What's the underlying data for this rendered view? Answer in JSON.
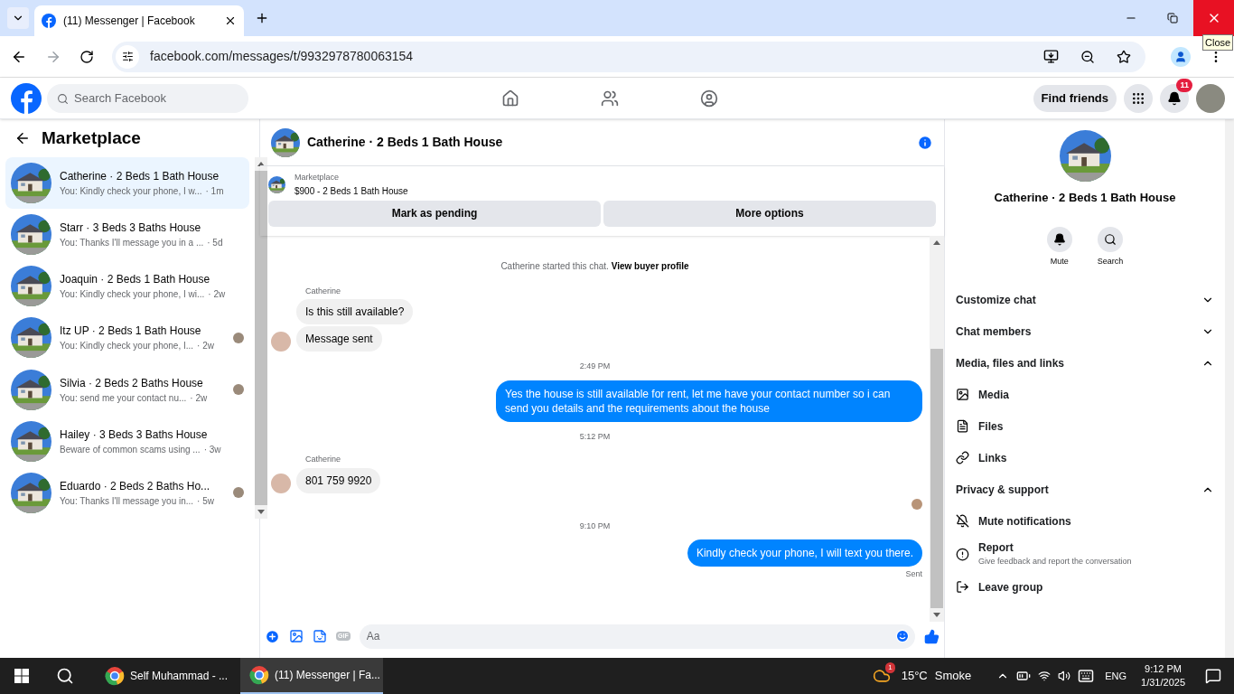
{
  "browser": {
    "tab_title": "(11) Messenger | Facebook",
    "url": "facebook.com/messages/t/9932978780063154",
    "tooltip": "Close"
  },
  "facebook_header": {
    "search_placeholder": "Search Facebook",
    "find_friends": "Find friends",
    "notification_count": "11"
  },
  "sidebar": {
    "title": "Marketplace",
    "conversations": [
      {
        "title": "Catherine · 2 Beds 1 Bath House",
        "preview": "You: Kindly check your phone, I w...",
        "time": "· 1m",
        "selected": true,
        "seen_avatar": false
      },
      {
        "title": "Starr · 3 Beds 3 Baths House",
        "preview": "You: Thanks I'll message you in a ...",
        "time": "· 5d",
        "selected": false,
        "seen_avatar": false
      },
      {
        "title": "Joaquin · 2 Beds 1 Bath House",
        "preview": "You: Kindly check your phone, I wi...",
        "time": "· 2w",
        "selected": false,
        "seen_avatar": false
      },
      {
        "title": "Itz UP · 2 Beds 1 Bath House",
        "preview": "You: Kindly check your phone, I...",
        "time": "· 2w",
        "selected": false,
        "seen_avatar": true
      },
      {
        "title": "Silvia · 2 Beds 2 Baths House",
        "preview": "You: send me your contact nu...",
        "time": "· 2w",
        "selected": false,
        "seen_avatar": true
      },
      {
        "title": "Hailey · 3 Beds 3 Baths House",
        "preview": "Beware of common scams using ...",
        "time": "· 3w",
        "selected": false,
        "seen_avatar": false
      },
      {
        "title": "Eduardo · 2 Beds 2 Baths Ho...",
        "preview": "You: Thanks I'll message you in...",
        "time": "· 5w",
        "selected": false,
        "seen_avatar": true
      }
    ]
  },
  "chat": {
    "title": "Catherine · 2 Beds 1 Bath House",
    "listing_label": "Marketplace",
    "listing": "$900 - 2 Beds 1 Bath House",
    "buttons": [
      "Mark as pending",
      "More options"
    ],
    "messages": [
      {
        "kind": "notice",
        "text": "Catherine started this chat.",
        "link": "View buyer profile"
      },
      {
        "kind": "incoming",
        "sender": "Catherine",
        "bubbles": [
          "Is this still available?",
          "Message sent"
        ]
      },
      {
        "kind": "time",
        "text": "2:49 PM"
      },
      {
        "kind": "outgoing",
        "bubbles": [
          "Yes the house is still available for rent, let me have your contact number so i can send you details and the requirements about the house"
        ]
      },
      {
        "kind": "time",
        "text": "5:12 PM"
      },
      {
        "kind": "incoming",
        "sender": "Catherine",
        "bubbles": [
          "801 759 9920"
        ]
      },
      {
        "kind": "seen"
      },
      {
        "kind": "time",
        "text": "9:10 PM"
      },
      {
        "kind": "outgoing",
        "bubbles": [
          "Kindly check your phone, I will text you there."
        ],
        "status": "Sent"
      }
    ],
    "composer": {
      "placeholder": "Aa",
      "gif_label": "GIF"
    }
  },
  "details": {
    "title": "Catherine · 2 Beds 1 Bath House",
    "actions": [
      {
        "kind": "mute",
        "label": "Mute"
      },
      {
        "kind": "search",
        "label": "Search"
      }
    ],
    "sections": [
      {
        "title": "Customize chat",
        "expanded": false
      },
      {
        "title": "Chat members",
        "expanded": false
      },
      {
        "title": "Media, files and links",
        "expanded": true,
        "items": [
          {
            "kind": "media",
            "label": "Media"
          },
          {
            "kind": "files",
            "label": "Files"
          },
          {
            "kind": "links",
            "label": "Links"
          }
        ]
      },
      {
        "title": "Privacy & support",
        "expanded": true,
        "items": [
          {
            "kind": "mute",
            "label": "Mute notifications"
          },
          {
            "kind": "report",
            "label": "Report",
            "description": "Give feedback and report the conversation"
          },
          {
            "kind": "leave",
            "label": "Leave group"
          }
        ]
      }
    ]
  },
  "taskbar": {
    "apps": [
      {
        "label": "Self Muhammad - ...",
        "selected": false
      },
      {
        "label": "(11) Messenger | Fa...",
        "selected": true
      }
    ],
    "weather_badge": "1",
    "temperature": "15°C",
    "weather": "Smoke",
    "language": "ENG",
    "time": "9:12 PM",
    "date": "1/31/2025"
  }
}
